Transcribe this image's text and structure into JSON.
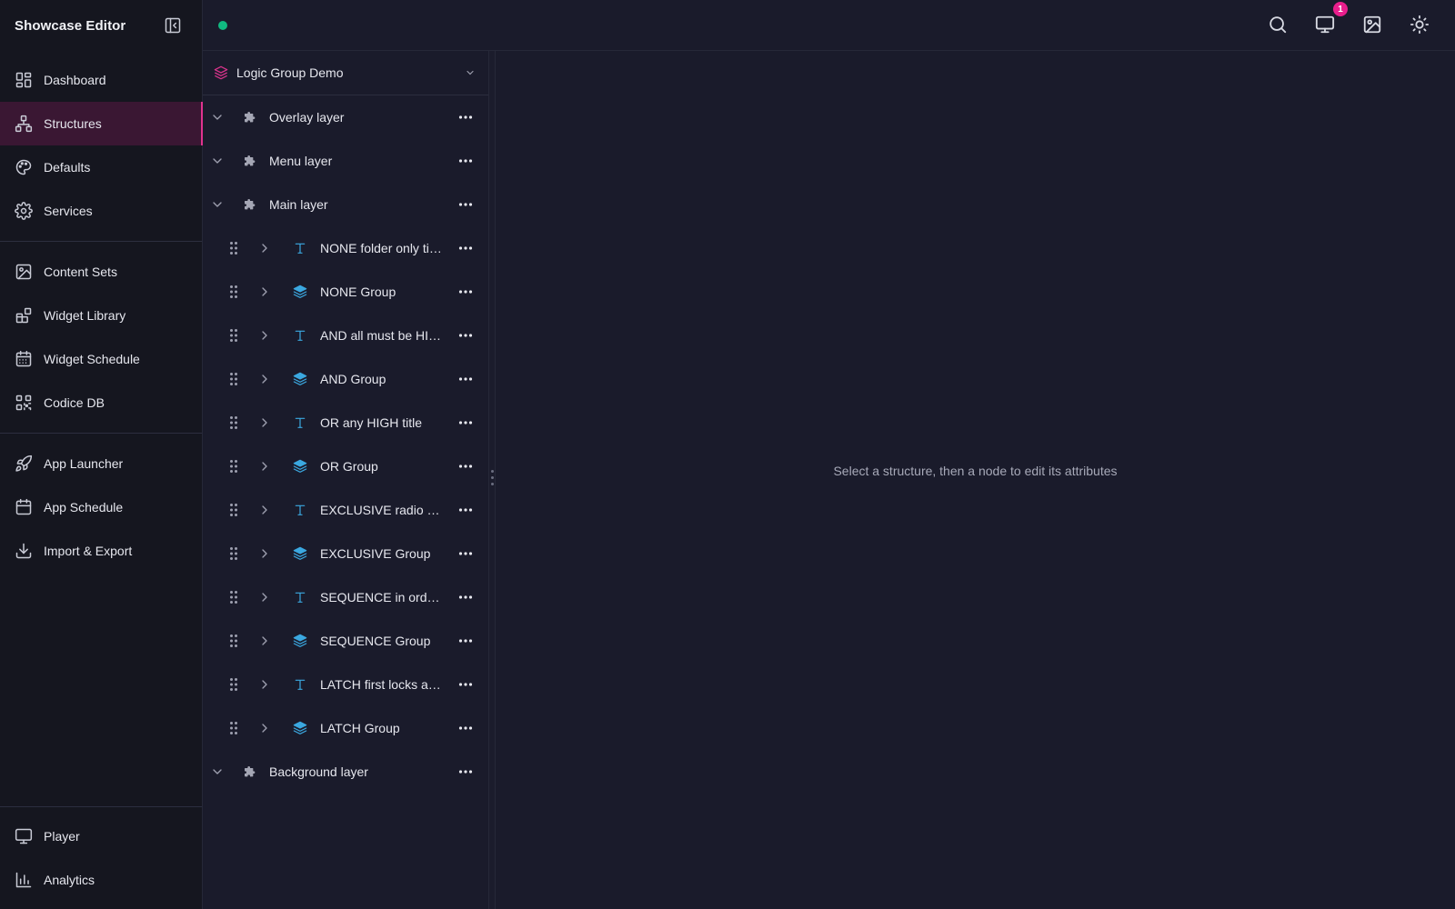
{
  "app": {
    "title": "Showcase Editor"
  },
  "sidebar": {
    "groups": [
      [
        {
          "label": "Dashboard",
          "icon": "dashboard-icon"
        },
        {
          "label": "Structures",
          "icon": "structures-icon",
          "active": true
        },
        {
          "label": "Defaults",
          "icon": "palette-icon"
        },
        {
          "label": "Services",
          "icon": "gear-icon"
        }
      ],
      [
        {
          "label": "Content Sets",
          "icon": "image-icon"
        },
        {
          "label": "Widget Library",
          "icon": "widgets-icon"
        },
        {
          "label": "Widget Schedule",
          "icon": "calendar-grid-icon"
        },
        {
          "label": "Codice DB",
          "icon": "qr-code-icon"
        }
      ],
      [
        {
          "label": "App Launcher",
          "icon": "rocket-icon"
        },
        {
          "label": "App Schedule",
          "icon": "calendar-icon"
        },
        {
          "label": "Import & Export",
          "icon": "download-icon"
        }
      ]
    ],
    "bottom": [
      {
        "label": "Player",
        "icon": "monitor-icon"
      },
      {
        "label": "Analytics",
        "icon": "bar-chart-icon"
      }
    ]
  },
  "topbar": {
    "notification_count": "1",
    "status_color": "#10b981"
  },
  "structure": {
    "selected": "Logic Group Demo",
    "layers_top": [
      {
        "label": "Overlay layer"
      },
      {
        "label": "Menu layer"
      },
      {
        "label": "Main layer"
      }
    ],
    "children": [
      {
        "label": "NONE folder only title",
        "type": "title"
      },
      {
        "label": "NONE Group",
        "type": "group"
      },
      {
        "label": "AND all must be HI…",
        "type": "title"
      },
      {
        "label": "AND Group",
        "type": "group"
      },
      {
        "label": "OR any HIGH title",
        "type": "title"
      },
      {
        "label": "OR Group",
        "type": "group"
      },
      {
        "label": "EXCLUSIVE radio …",
        "type": "title"
      },
      {
        "label": "EXCLUSIVE Group",
        "type": "group"
      },
      {
        "label": "SEQUENCE in ord…",
        "type": "title"
      },
      {
        "label": "SEQUENCE Group",
        "type": "group"
      },
      {
        "label": "LATCH first locks a…",
        "type": "title"
      },
      {
        "label": "LATCH Group",
        "type": "group"
      }
    ],
    "layers_bottom": [
      {
        "label": "Background layer"
      }
    ]
  },
  "main": {
    "empty_message": "Select a structure, then a node to edit its attributes"
  },
  "colors": {
    "accent": "#e0338f",
    "type_icon": "#3ba8e0",
    "active_bg": "#3a1733"
  }
}
